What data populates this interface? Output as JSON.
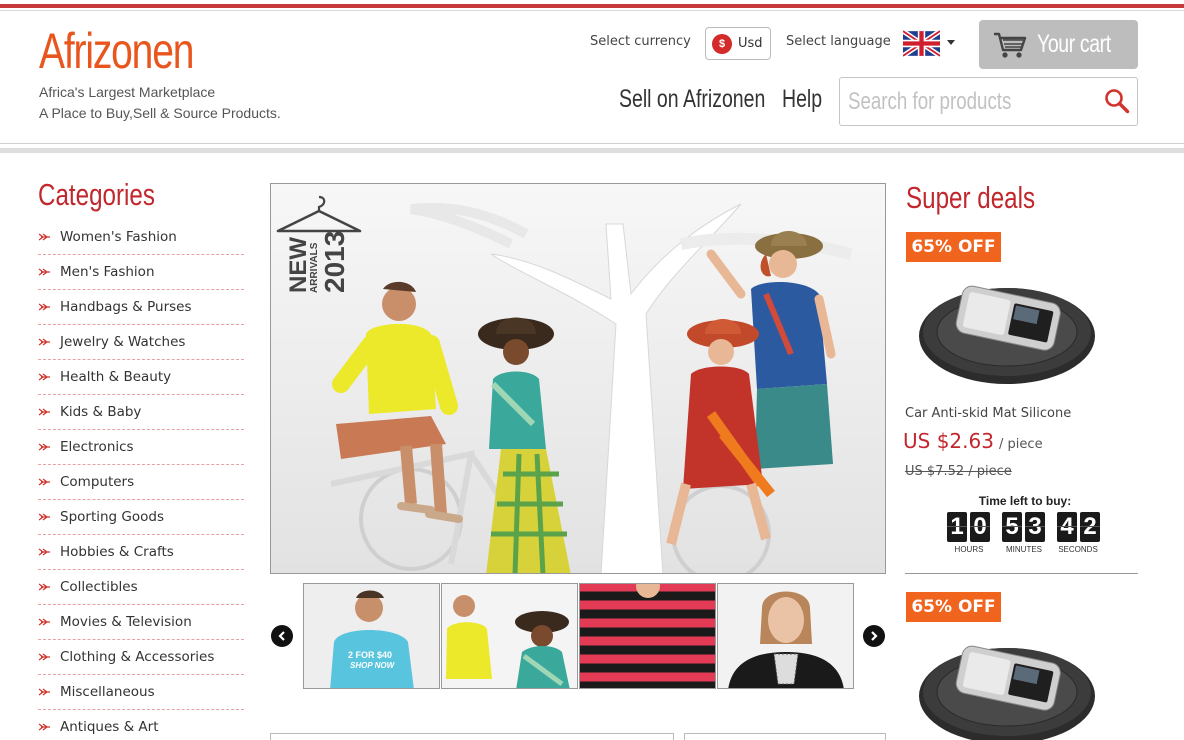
{
  "brand": {
    "logo_text": "Afrizonen",
    "tagline_1": "Africa's Largest Marketplace",
    "tagline_2": "A Place to Buy,Sell & Source Products.",
    "accent_color": "#e8561e",
    "title_color": "#c1272d"
  },
  "header": {
    "currency_label": "Select currency",
    "currency_symbol": "$",
    "currency_value": "Usd",
    "language_label": "Select language",
    "language_flag": "uk-flag-icon",
    "cart_label": "Your cart",
    "nav": [
      {
        "label": "Sell on Afrizonen"
      },
      {
        "label": "Help"
      }
    ],
    "search_placeholder": "Search for products"
  },
  "categories": {
    "title": "Categories",
    "items": [
      {
        "label": "Women's Fashion"
      },
      {
        "label": "Men's Fashion"
      },
      {
        "label": "Handbags & Purses"
      },
      {
        "label": "Jewelry & Watches"
      },
      {
        "label": "Health & Beauty"
      },
      {
        "label": "Kids & Baby"
      },
      {
        "label": "Electronics"
      },
      {
        "label": "Computers"
      },
      {
        "label": "Sporting Goods"
      },
      {
        "label": "Hobbies & Crafts"
      },
      {
        "label": "Collectibles"
      },
      {
        "label": "Movies & Television"
      },
      {
        "label": "Clothing & Accessories"
      },
      {
        "label": "Miscellaneous"
      },
      {
        "label": "Antiques & Art"
      }
    ]
  },
  "banner": {
    "badge_line1": "NEW",
    "badge_line2": "ARRIVALS",
    "badge_line3": "2013",
    "thumb1_text_1": "2 FOR $40",
    "thumb1_text_2": "SHOP NOW"
  },
  "deals": {
    "title": "Super deals",
    "timer_label": "Time left to buy:",
    "timer_units": [
      "HOURS",
      "MINUTES",
      "SECONDS"
    ],
    "timer_digits": [
      "1",
      "0",
      "5",
      "3",
      "4",
      "2"
    ],
    "items": [
      {
        "badge": "65% OFF",
        "name": "Car Anti-skid Mat Silicone",
        "price": "US $2.63",
        "price_unit": "/ piece",
        "old_price": "US $7.52 / piece"
      },
      {
        "badge": "65% OFF"
      }
    ]
  }
}
